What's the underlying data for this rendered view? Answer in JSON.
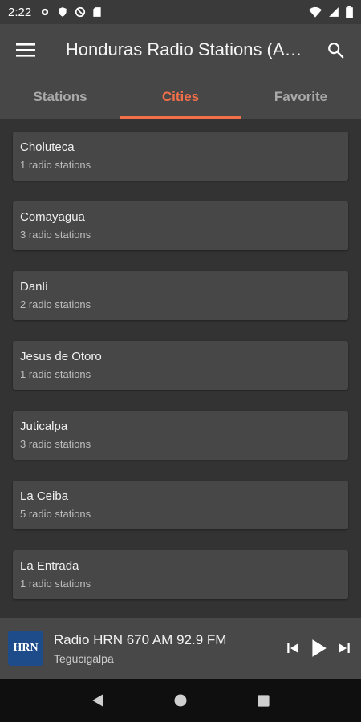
{
  "status_bar": {
    "time": "2:22",
    "icons": [
      "settings-icon",
      "shield-icon",
      "data-saver-icon",
      "sd-card-icon"
    ],
    "right_icons": [
      "wifi-icon",
      "signal-icon",
      "battery-icon"
    ]
  },
  "app_bar": {
    "title": "Honduras Radio Stations (A…",
    "menu_icon": "menu-icon",
    "search_icon": "search-icon"
  },
  "tabs": [
    {
      "label": "Stations",
      "active": false
    },
    {
      "label": "Cities",
      "active": true
    },
    {
      "label": "Favorite",
      "active": false
    }
  ],
  "cities": [
    {
      "name": "Choluteca",
      "count": "1 radio stations"
    },
    {
      "name": "Comayagua",
      "count": "3 radio stations"
    },
    {
      "name": "Danlí",
      "count": "2 radio stations"
    },
    {
      "name": "Jesus de Otoro",
      "count": "1 radio stations"
    },
    {
      "name": "Juticalpa",
      "count": "3 radio stations"
    },
    {
      "name": "La Ceiba",
      "count": "5 radio stations"
    },
    {
      "name": "La Entrada",
      "count": "1 radio stations"
    }
  ],
  "player": {
    "logo_text": "HRN",
    "title": "Radio HRN 670 AM 92.9 FM",
    "subtitle": "Tegucigalpa"
  },
  "colors": {
    "accent": "#f26f4a",
    "background": "#333333",
    "card": "#474747"
  }
}
